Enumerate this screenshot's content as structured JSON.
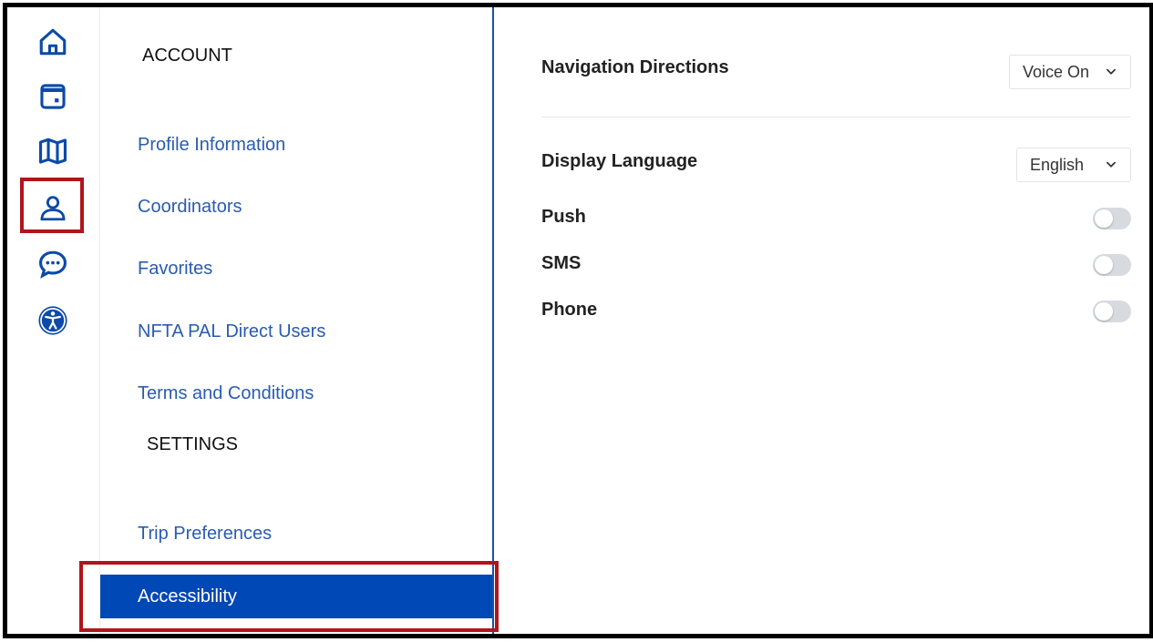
{
  "rail": {
    "items": [
      {
        "icon": "home-icon"
      },
      {
        "icon": "calendar-icon"
      },
      {
        "icon": "map-icon"
      },
      {
        "icon": "profile-icon",
        "selected": true
      },
      {
        "icon": "chat-icon"
      },
      {
        "icon": "accessibility-icon"
      }
    ],
    "icon_color": "#0b4aa8"
  },
  "menu": {
    "account_title": "ACCOUNT",
    "account_items": [
      "Profile Information",
      "Coordinators",
      "Favorites",
      "NFTA PAL Direct Users",
      "Terms and Conditions"
    ],
    "settings_title": "SETTINGS",
    "settings_items": [
      "Trip Preferences",
      "Accessibility"
    ],
    "active_item": "Accessibility"
  },
  "content": {
    "navigation_directions": {
      "label": "Navigation Directions",
      "value": "Voice On"
    },
    "display_language": {
      "label": "Display Language",
      "value": "English"
    },
    "toggles": [
      {
        "label": "Push",
        "on": false
      },
      {
        "label": "SMS",
        "on": false
      },
      {
        "label": "Phone",
        "on": false
      }
    ]
  },
  "colors": {
    "accent": "#0048b5",
    "highlight": "#b0151b",
    "link": "#2a5bb0"
  }
}
